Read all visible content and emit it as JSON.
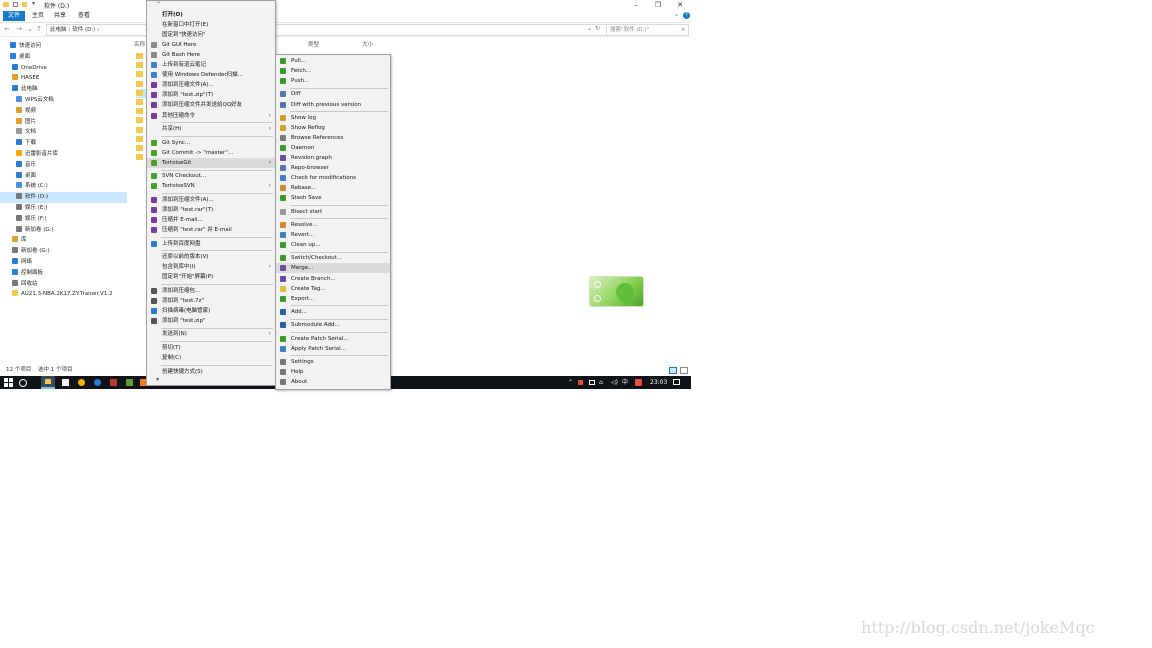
{
  "explorer": {
    "title": "软件 (D:)",
    "ribbon_tabs": [
      "文件",
      "主页",
      "共享",
      "查看"
    ],
    "address": "此电脑 › 软件 (D:) ›",
    "search_placeholder": "搜索\"软件 (D:)\"",
    "columns": [
      "名称",
      "类型",
      "大小"
    ],
    "nav_items": [
      {
        "label": "快速访问",
        "icon": "star-icon",
        "color": "#2b7cd3"
      },
      {
        "label": "桌面",
        "icon": "desktop-icon",
        "color": "#2b7cd3"
      },
      {
        "label": "OneDrive",
        "icon": "cloud-icon",
        "color": "#2b7cd3"
      },
      {
        "label": "HASEE",
        "icon": "user-icon",
        "color": "#e0a030"
      },
      {
        "label": "此电脑",
        "icon": "computer-icon",
        "color": "#2b7cd3"
      },
      {
        "label": "WPS云文档",
        "icon": "cloud-icon",
        "color": "#4a8fe0"
      },
      {
        "label": "视频",
        "icon": "video-icon",
        "color": "#e0a030"
      },
      {
        "label": "图片",
        "icon": "picture-icon",
        "color": "#e0a030"
      },
      {
        "label": "文档",
        "icon": "document-icon",
        "color": "#999999"
      },
      {
        "label": "下载",
        "icon": "download-icon",
        "color": "#2b7cd3"
      },
      {
        "label": "迅雷影音片库",
        "icon": "folder-icon",
        "color": "#f2a900"
      },
      {
        "label": "音乐",
        "icon": "music-icon",
        "color": "#2b7cd3"
      },
      {
        "label": "桌面",
        "icon": "desktop-icon",
        "color": "#2b7cd3"
      },
      {
        "label": "系统 (C:)",
        "icon": "drive-icon",
        "color": "#4a8fe0"
      },
      {
        "label": "软件 (D:)",
        "icon": "drive-icon",
        "color": "#777777",
        "selected": true
      },
      {
        "label": "娱乐 (E:)",
        "icon": "drive-icon",
        "color": "#777777"
      },
      {
        "label": "娱乐 (F:)",
        "icon": "drive-icon",
        "color": "#777777"
      },
      {
        "label": "新加卷 (G:)",
        "icon": "drive-icon",
        "color": "#777777"
      },
      {
        "label": "库",
        "icon": "library-icon",
        "color": "#e0a030"
      },
      {
        "label": "新加卷 (G:)",
        "icon": "drive-icon",
        "color": "#777777"
      },
      {
        "label": "网络",
        "icon": "network-icon",
        "color": "#2b7cd3"
      },
      {
        "label": "控制面板",
        "icon": "control-panel-icon",
        "color": "#2b7cd3"
      },
      {
        "label": "回收站",
        "icon": "recycle-bin-icon",
        "color": "#777777"
      },
      {
        "label": "AU21.3-NBA.2K17.ZY.Trainer.V1.2",
        "icon": "folder-icon",
        "color": "#f2c94c"
      }
    ],
    "status_count": "12 个项目",
    "status_selected": "选中 1 个项目"
  },
  "context_menu": {
    "items": [
      {
        "label": "打开(O)",
        "bold": true
      },
      {
        "label": "在新窗口中打开(E)"
      },
      {
        "label": "固定到\"快速访问\""
      },
      {
        "label": "Git GUI Here",
        "icon": "git-gui-icon",
        "color": "#8a8a8a"
      },
      {
        "label": "Git Bash Here",
        "icon": "git-bash-icon",
        "color": "#8a8a8a"
      },
      {
        "label": "上传到有道云笔记",
        "icon": "youdao-note-icon",
        "color": "#3b7fd6"
      },
      {
        "label": "使用 Windows Defender扫描...",
        "icon": "defender-icon",
        "color": "#3b7fd6"
      },
      {
        "label": "添加到压缩文件(A)...",
        "icon": "archive-icon",
        "color": "#7a3b9e"
      },
      {
        "label": "添加到 \"test.zip\"(T)",
        "icon": "archive-icon",
        "color": "#7a3b9e"
      },
      {
        "label": "添加到压缩文件并发送给QQ好友",
        "icon": "archive-icon",
        "color": "#7a3b9e"
      },
      {
        "label": "其他压缩命令",
        "icon": "archive-icon",
        "color": "#7a3b9e",
        "submenu": true
      },
      {
        "separator": true
      },
      {
        "label": "共享(H)",
        "submenu": true
      },
      {
        "separator": true
      },
      {
        "label": "Git Sync...",
        "icon": "git-sync-icon",
        "color": "#4aa02c"
      },
      {
        "label": "Git Commit -> \"master\"...",
        "icon": "git-commit-icon",
        "color": "#4aa02c"
      },
      {
        "label": "TortoiseGit",
        "icon": "tortoisegit-icon",
        "color": "#4aa02c",
        "submenu": true,
        "highlight": true
      },
      {
        "separator": true
      },
      {
        "label": "SVN Checkout...",
        "icon": "svn-icon",
        "color": "#4aa02c"
      },
      {
        "label": "TortoiseSVN",
        "icon": "tortoisesvn-icon",
        "color": "#4aa02c",
        "submenu": true
      },
      {
        "separator": true
      },
      {
        "label": "添加到压缩文件(A)...",
        "icon": "winrar-icon",
        "color": "#7a3b9e"
      },
      {
        "label": "添加到 \"test.rar\"(T)",
        "icon": "winrar-icon",
        "color": "#7a3b9e"
      },
      {
        "label": "压缩并 E-mail...",
        "icon": "winrar-icon",
        "color": "#7a3b9e"
      },
      {
        "label": "压缩到 \"test.rar\" 并 E-mail",
        "icon": "winrar-icon",
        "color": "#7a3b9e"
      },
      {
        "separator": true
      },
      {
        "label": "上传到百度网盘",
        "icon": "baidu-pan-icon",
        "color": "#2b7cd3"
      },
      {
        "separator": true
      },
      {
        "label": "还原以前的版本(V)"
      },
      {
        "label": "包含到库中(I)",
        "submenu": true
      },
      {
        "label": "固定到\"开始\"屏幕(P)"
      },
      {
        "separator": true
      },
      {
        "label": "添加到压缩包...",
        "icon": "7zip-icon",
        "color": "#555555"
      },
      {
        "label": "添加到 \"test.7z\"",
        "icon": "7zip-icon",
        "color": "#555555"
      },
      {
        "label": "扫描病毒(电脑管家)",
        "icon": "antivirus-icon",
        "color": "#2b7cd3"
      },
      {
        "label": "添加到 \"test.zip\"",
        "icon": "7zip-icon",
        "color": "#555555"
      },
      {
        "separator": true
      },
      {
        "label": "发送到(N)",
        "submenu": true
      },
      {
        "separator": true
      },
      {
        "label": "剪切(T)"
      },
      {
        "label": "复制(C)"
      },
      {
        "separator": true
      },
      {
        "label": "创建快捷方式(S)"
      }
    ]
  },
  "tortoisegit_submenu": {
    "items": [
      {
        "label": "Pull...",
        "icon": "pull-icon",
        "color": "#3c9a2d"
      },
      {
        "label": "Fetch...",
        "icon": "fetch-icon",
        "color": "#3c9a2d"
      },
      {
        "label": "Push...",
        "icon": "push-icon",
        "color": "#3c9a2d"
      },
      {
        "separator": true
      },
      {
        "label": "Diff",
        "icon": "diff-icon",
        "color": "#5577aa"
      },
      {
        "label": "Diff with previous version",
        "icon": "diff-icon",
        "color": "#5577aa"
      },
      {
        "separator": true
      },
      {
        "label": "Show log",
        "icon": "log-icon",
        "color": "#c9a227"
      },
      {
        "label": "Show Reflog",
        "icon": "reflog-icon",
        "color": "#c9a227"
      },
      {
        "label": "Browse References",
        "icon": "references-icon",
        "color": "#7a7a7a"
      },
      {
        "label": "Daemon",
        "icon": "daemon-icon",
        "color": "#3c9a2d"
      },
      {
        "label": "Revision graph",
        "icon": "revision-graph-icon",
        "color": "#6b4f9e"
      },
      {
        "label": "Repo-browser",
        "icon": "repo-browser-icon",
        "color": "#5577aa"
      },
      {
        "label": "Check for modifications",
        "icon": "check-modifications-icon",
        "color": "#3c7fc4"
      },
      {
        "label": "Rebase...",
        "icon": "rebase-icon",
        "color": "#d18b2c"
      },
      {
        "label": "Stash Save",
        "icon": "stash-icon",
        "color": "#3c9a2d"
      },
      {
        "separator": true
      },
      {
        "label": "Bisect start",
        "icon": "bisect-icon",
        "color": "#999999"
      },
      {
        "separator": true
      },
      {
        "label": "Resolve...",
        "icon": "resolve-icon",
        "color": "#d18b2c"
      },
      {
        "label": "Revert...",
        "icon": "revert-icon",
        "color": "#3c7fc4"
      },
      {
        "label": "Clean up...",
        "icon": "cleanup-icon",
        "color": "#3c9a2d"
      },
      {
        "separator": true
      },
      {
        "label": "Switch/Checkout...",
        "icon": "switch-icon",
        "color": "#3c9a2d"
      },
      {
        "label": "Merge...",
        "icon": "merge-icon",
        "color": "#6b4f9e",
        "highlight": true
      },
      {
        "label": "Create Branch...",
        "icon": "branch-icon",
        "color": "#6b4f9e"
      },
      {
        "label": "Create Tag...",
        "icon": "tag-icon",
        "color": "#e0c23a"
      },
      {
        "label": "Export...",
        "icon": "export-icon",
        "color": "#3c9a2d"
      },
      {
        "separator": true
      },
      {
        "label": "Add...",
        "icon": "add-icon",
        "color": "#2b5fb0"
      },
      {
        "separator": true
      },
      {
        "label": "Submodule Add...",
        "icon": "submodule-icon",
        "color": "#2b5fb0"
      },
      {
        "separator": true
      },
      {
        "label": "Create Patch Serial...",
        "icon": "patch-icon",
        "color": "#3c9a2d"
      },
      {
        "label": "Apply Patch Serial...",
        "icon": "apply-patch-icon",
        "color": "#3c7fc4"
      },
      {
        "separator": true
      },
      {
        "label": "Settings",
        "icon": "settings-icon",
        "color": "#777777"
      },
      {
        "label": "Help",
        "icon": "help-icon",
        "color": "#777777"
      },
      {
        "label": "About",
        "icon": "about-icon",
        "color": "#777777"
      }
    ]
  },
  "taskbar": {
    "clock": "23:03",
    "ime": "中",
    "accent": "#1979ca"
  },
  "watermark": "http://blog.csdn.net/jokeMqc"
}
